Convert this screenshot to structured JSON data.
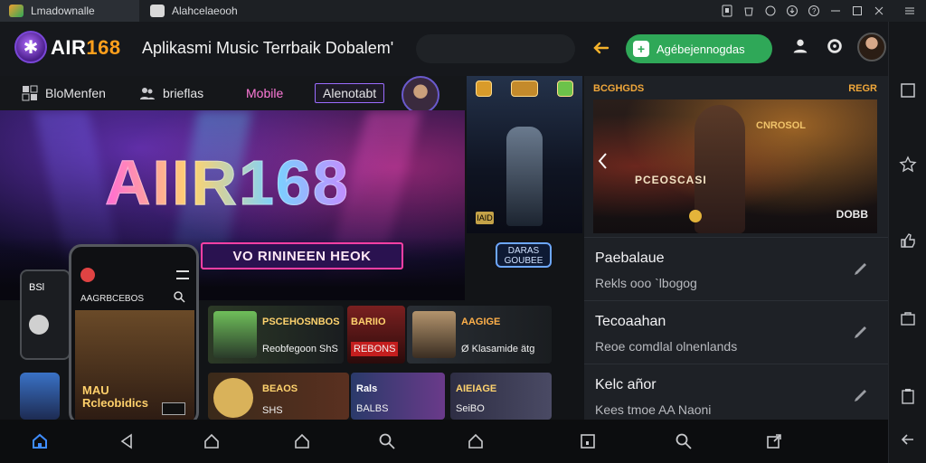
{
  "titlebar": {
    "tab1_label": "Lmadownalle",
    "tab2_label": "Alahcelaeooh"
  },
  "header": {
    "logo_text_a": "AIR",
    "logo_text_b": "168",
    "app_title": "Aplikasmi Music Terrbaik Dobalem'",
    "cta_label": "Agébejennogdas"
  },
  "nav": {
    "items": [
      {
        "label": "BloMenfen",
        "icon": "grid-icon"
      },
      {
        "label": "brieflas",
        "icon": "people-icon"
      },
      {
        "label": "Mobile"
      },
      {
        "label": "Alenotabt"
      }
    ]
  },
  "hero": {
    "title": "AIIR168",
    "subtitle": "VO RININEEN HEOK"
  },
  "game_tile": {
    "tag": "IAID",
    "button_text": "DARAS\nGOUBEE"
  },
  "phone_small": {
    "label": "BSl"
  },
  "phone": {
    "label": "AAGRBCEBOS",
    "caption_line1": "MAU",
    "caption_line2": "Rcleobidics"
  },
  "cards": [
    {
      "title": "PSCEHOSNBOS",
      "subtitle": "Reobfegoon ShS"
    },
    {
      "title": "BARIIO",
      "subtitle": "REBONS"
    },
    {
      "title": "AAGIGE",
      "subtitle": "Ø Klasamide ätg"
    },
    {
      "title": "BEAOS",
      "subtitle": "SHS"
    },
    {
      "title": "Rals",
      "subtitle": "BALBS"
    },
    {
      "title": "AIEIAGE",
      "subtitle": "SeiBO"
    }
  ],
  "right_panel": {
    "header_left": "BCGHGDS",
    "header_right": "REGR",
    "feature_text1": "PCEOSCASI",
    "feature_text2": "CNROSOL",
    "feature_text3": "DOBB",
    "list": [
      {
        "title": "Paebalaue",
        "subtitle": "Rekls ooo `lbogog"
      },
      {
        "title": "Tecoaahan",
        "subtitle": "Reoe comdlal olnenlands"
      },
      {
        "title": "Kelc añor",
        "subtitle": "Kees tmoe AA Naoni"
      }
    ]
  },
  "colors": {
    "accent": "#2fa858",
    "brand_orange": "#ff9f1c",
    "active_blue": "#3f8cff",
    "hero_border": "#ff3fa4"
  }
}
